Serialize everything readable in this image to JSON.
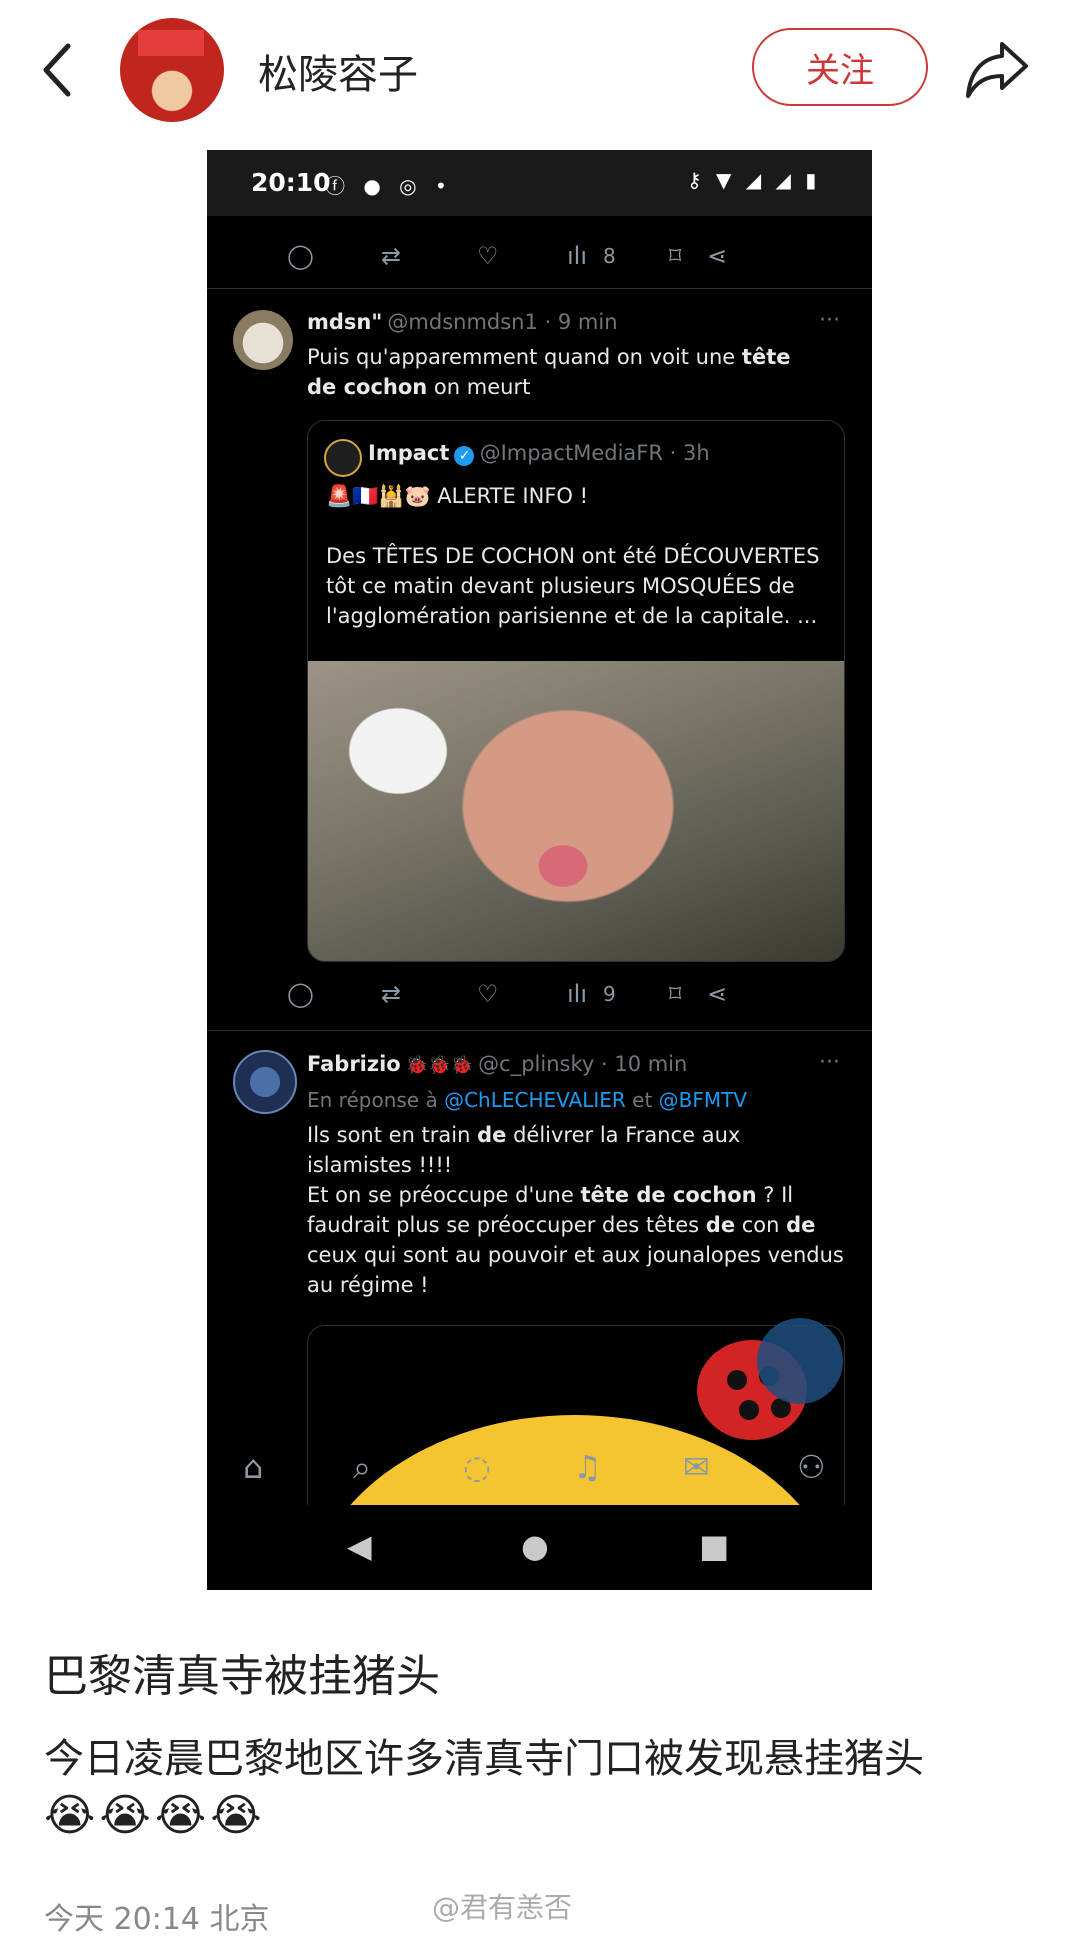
{
  "header": {
    "author": "松陵容子",
    "follow_label": "关注"
  },
  "screenshot": {
    "status_time": "20:10",
    "top_actions": {
      "views": "8"
    },
    "tweet1": {
      "name": "mdsn\"",
      "handle": "@mdsnmdsn1 · 9 min",
      "text_a": "Puis qu'apparemment quand on voit une ",
      "text_b": "tête de cochon",
      "text_c": " on meurt",
      "quote": {
        "name": "Impact",
        "handle": "@ImpactMediaFR · 3h",
        "alert": "🚨🇫🇷🕌🐷 ALERTE INFO !",
        "body": "Des TÊTES DE COCHON ont été DÉCOUVERTES tôt ce matin devant plusieurs MOSQUÉES de l'agglomération parisienne et de la capitale. ..."
      },
      "views": "9"
    },
    "tweet2": {
      "name": "Fabrizio",
      "badges": "🐞🐞🐞",
      "handle": "@c_plinsky · 10 min",
      "reply_prefix": "En réponse à ",
      "reply_to1": "@ChLECHEVALIER",
      "reply_and": " et ",
      "reply_to2": "@BFMTV",
      "p1_a": "Ils sont en train ",
      "p1_b": "de",
      "p1_c": " délivrer la France aux islamistes !!!!",
      "p2_a": "Et on se préoccupe d'une ",
      "p2_b": "tête de cochon",
      "p2_c": " ? Il faudrait plus se préoccuper des têtes ",
      "p2_d": "de",
      "p2_e": " con ",
      "p2_f": "de",
      "p2_g": " ceux qui sont au pouvoir et aux jounalopes vendus au régime !"
    }
  },
  "post": {
    "title": "巴黎清真寺被挂猪头",
    "body": "今日凌晨巴黎地区许多清真寺门口被发现悬挂猪头",
    "emojis": "😭😭😭😭",
    "meta": "今天 20:14 北京",
    "watermark": "@君有恙否"
  },
  "icons": {
    "back": "chevron-left-icon",
    "share": "share-arrow-icon"
  }
}
